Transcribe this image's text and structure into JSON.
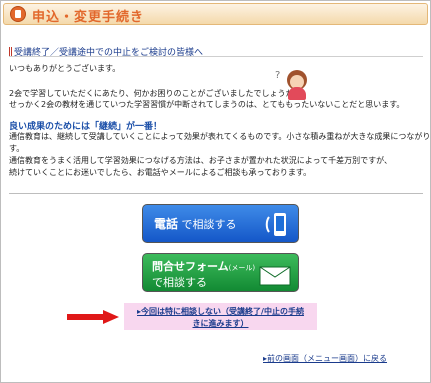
{
  "header": {
    "title": "申込・変更手続き"
  },
  "section": {
    "title": "受講終了／受講途中での中止をご検討の皆様へ"
  },
  "body": {
    "greeting": "いつもありがとうございます。",
    "line1": "2会で学習していただくにあたり、何かお困りのことがございましたでしょうか？",
    "line2": "せっかく2会の教材を通じていつた学習習慣が中断されてしまうのは、とてももったいないことだと思います。",
    "headline": "良い成果のためには「継続」が一番！",
    "p1": "通信教育は、継続して受講していくことによって効果が表れてくるものです。小さな積み重ねが大きな成果につながりま",
    "p2": "す。",
    "p3": "通信教育をうまく活用して学習効果につなげる方法は、お子さまが置かれた状況によって千差万別ですが、",
    "p4": "続けていくことにお迷いでしたら、お電話やメールによるご相談も承っております。"
  },
  "buttons": {
    "phone_strong": "電話",
    "phone_rest": " で相談する",
    "form_line1": "問合せフォーム",
    "form_small": "(メール)",
    "form_line2": "で相談する"
  },
  "cancel": {
    "line1": "▸今回は特に相談しない（受講終了/中止の手続",
    "line2": "きに進みます）"
  },
  "back": {
    "label": "▸前の画面（メニュー画面）に戻る"
  },
  "colors": {
    "accent": "#e2682c",
    "phone_button": "#1457c8",
    "form_button": "#128a33",
    "link": "#1a3b8c"
  }
}
